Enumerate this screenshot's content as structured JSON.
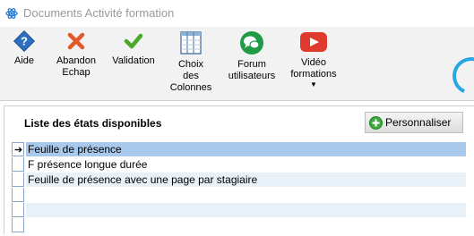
{
  "window": {
    "title": "Documents Activité formation",
    "icon": "atom-icon"
  },
  "toolbar": {
    "items": [
      {
        "label": "Aide",
        "icon": "help-icon"
      },
      {
        "label": "Abandon\nEchap",
        "icon": "cancel-x-icon"
      },
      {
        "label": "Validation",
        "icon": "checkmark-icon"
      },
      {
        "label": "Choix\ndes\nColonnes",
        "icon": "columns-icon"
      },
      {
        "label": "Forum\nutilisateurs",
        "icon": "forum-chat-icon"
      },
      {
        "label": "Vidéo\nformations",
        "icon": "video-play-icon",
        "dropdown": true
      }
    ]
  },
  "panel": {
    "title": "Liste des états disponibles",
    "customize_label": "Personnaliser"
  },
  "list": {
    "rows": [
      {
        "label": "Feuille de présence",
        "selected": true
      },
      {
        "label": "F présence longue durée",
        "selected": false
      },
      {
        "label": "Feuille de présence avec une page par stagiaire",
        "selected": false
      },
      {
        "label": "",
        "selected": false
      },
      {
        "label": "",
        "selected": false
      },
      {
        "label": "",
        "selected": false
      }
    ]
  },
  "colors": {
    "selection": "#a8c8ec",
    "alt_row": "#e8f0f8",
    "toolbar_bg": "#f2f2f2"
  }
}
